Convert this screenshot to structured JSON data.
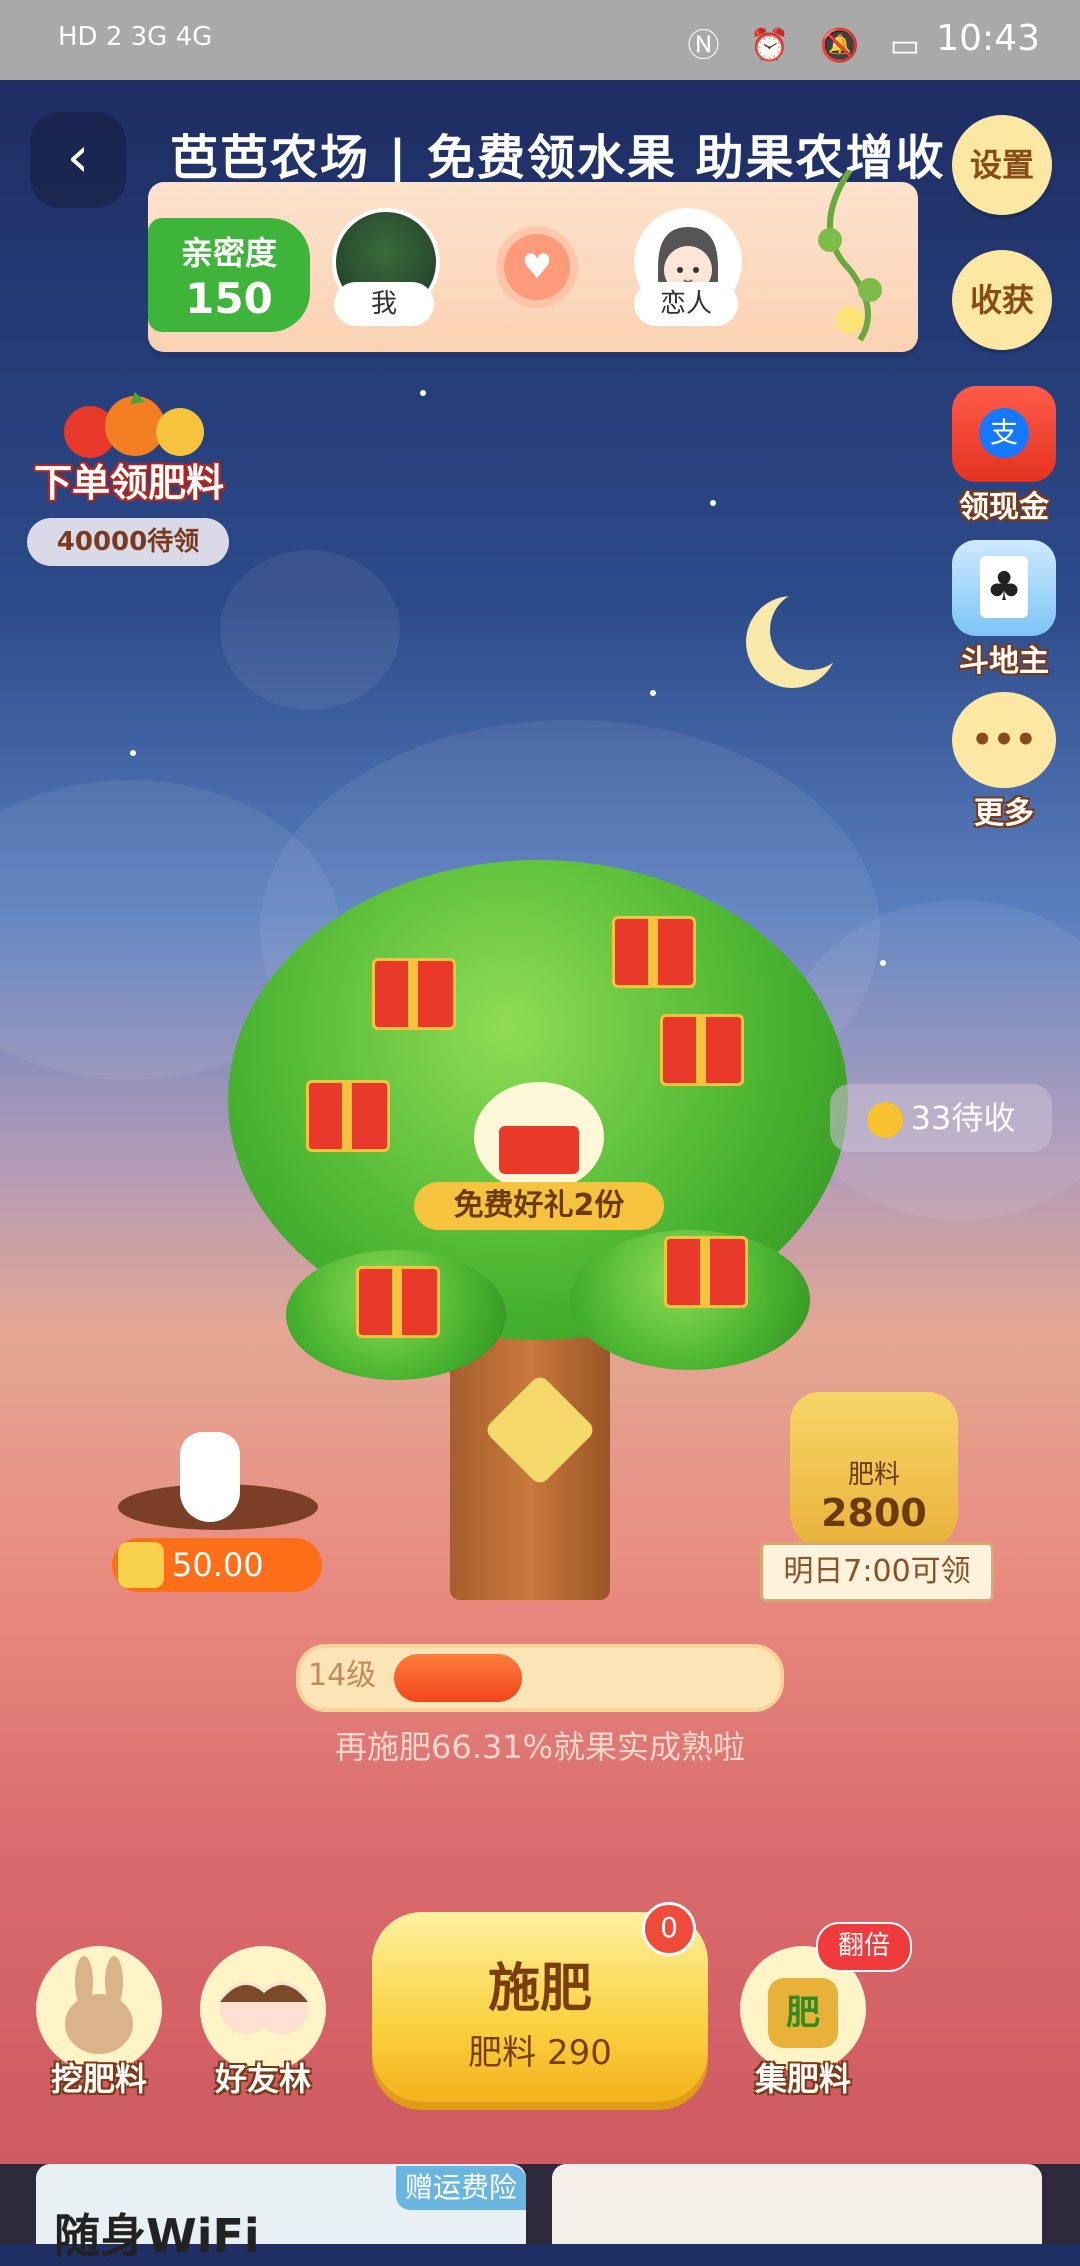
{
  "status_bar": {
    "left_text": "HD 2 3G 4G",
    "time": "10:43"
  },
  "header": {
    "title": "芭芭农场 | 免费领水果 助果农增收"
  },
  "intimacy": {
    "label": "亲密度",
    "value": "150",
    "me_label": "我",
    "lover_label": "恋人"
  },
  "side_menu": {
    "settings": "设置",
    "harvest": "收获",
    "cash": "领现金",
    "landlord": "斗地主",
    "more": "更多",
    "more_dots": "•••"
  },
  "order_promo": {
    "label": "下单领肥料",
    "pending": "40000待领"
  },
  "tree": {
    "free_gift": "免费好礼2份",
    "pending_harvest": "33待收",
    "fertilizer_bag_label": "肥料",
    "fertilizer_bag_value": "2800",
    "fertilizer_bag_note": "明日7:00可领",
    "coin_value": "50.00",
    "level": "14级",
    "level_progress": 0.33,
    "hint": "再施肥66.31%就果实成熟啦"
  },
  "bottom_bar": {
    "dig": "挖肥料",
    "friends": "好友林",
    "fertilize_main": "施肥",
    "fertilize_sub": "肥料 290",
    "fertilize_badge": "0",
    "collect": "集肥料",
    "collect_icon_text": "肥",
    "double_tag": "翻倍"
  },
  "ads": {
    "left_tag": "赠运费险",
    "left_title": "随身WiFi"
  }
}
